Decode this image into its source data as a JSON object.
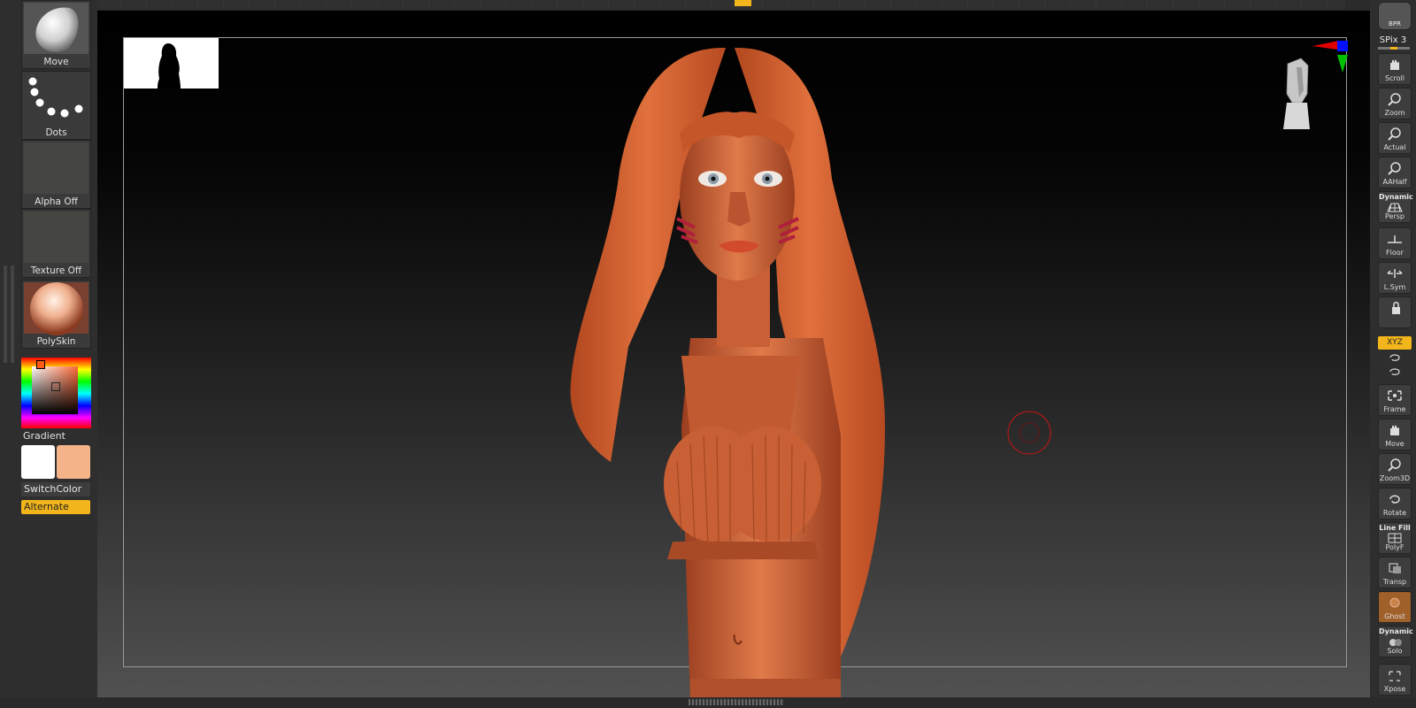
{
  "left_shelf": {
    "tools": [
      {
        "label": "Move",
        "icon": "brush-move-icon"
      },
      {
        "label": "Dots",
        "icon": "stroke-dots-icon"
      },
      {
        "label": "Alpha Off",
        "icon": "alpha-empty-icon"
      },
      {
        "label": "Texture Off",
        "icon": "texture-empty-icon"
      },
      {
        "label": "PolySkin",
        "icon": "material-polyskin-icon"
      }
    ],
    "gradient_label": "Gradient",
    "switch_color_label": "SwitchColor",
    "alternate_label": "Alternate",
    "colors": {
      "main": "#ffffff",
      "secondary": "#f5b38a",
      "accent": "#f2b51b"
    }
  },
  "right_shelf": {
    "bpr_label": "BPR",
    "spix_label": "SPix 3",
    "buttons": [
      {
        "label": "Scroll",
        "top_label": ""
      },
      {
        "label": "Zoom",
        "top_label": ""
      },
      {
        "label": "Actual",
        "top_label": ""
      },
      {
        "label": "AAHalf",
        "top_label": ""
      },
      {
        "label": "Persp",
        "top_label": "Dynamic"
      },
      {
        "label": "Floor",
        "top_label": ""
      },
      {
        "label": "L.Sym",
        "top_label": ""
      },
      {
        "label": "",
        "top_label": ""
      },
      {
        "label": "Frame",
        "top_label": ""
      },
      {
        "label": "Move",
        "top_label": ""
      },
      {
        "label": "Zoom3D",
        "top_label": ""
      },
      {
        "label": "Rotate",
        "top_label": ""
      },
      {
        "label": "PolyF",
        "top_label": "Line Fill"
      },
      {
        "label": "Transp",
        "top_label": ""
      },
      {
        "label": "Ghost",
        "top_label": ""
      },
      {
        "label": "Solo",
        "top_label": "Dynamic"
      },
      {
        "label": "Xpose",
        "top_label": ""
      }
    ],
    "xyz_label": "XYZ"
  },
  "viewport": {
    "model_color": "#d9683c",
    "background_top": "#000000",
    "background_bottom": "#515151"
  }
}
